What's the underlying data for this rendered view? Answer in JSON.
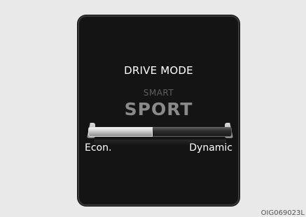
{
  "display": {
    "title": "DRIVE MODE",
    "sub_label": "SMART",
    "mode_label": "SPORT",
    "slider": {
      "level": 0.45,
      "left_label": "Econ.",
      "right_label": "Dynamic"
    }
  },
  "caption": "OIG069023L"
}
